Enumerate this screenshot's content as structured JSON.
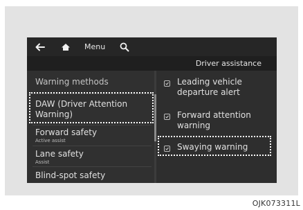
{
  "topbar": {
    "back_icon": "arrow-left-icon",
    "home_icon": "home-icon",
    "menu_label": "Menu",
    "search_icon": "search-icon"
  },
  "header": {
    "title": "Driver assistance"
  },
  "left_menu": {
    "items": [
      {
        "label": "Warning methods",
        "sub": ""
      },
      {
        "label": "DAW (Driver Attention Warning)",
        "sub": ""
      },
      {
        "label": "Forward safety",
        "sub": "Active assist"
      },
      {
        "label": "Lane safety",
        "sub": "Assist"
      },
      {
        "label": "Blind-spot safety",
        "sub": ""
      }
    ]
  },
  "options": [
    {
      "label": "Leading vehicle departure alert",
      "checked": true
    },
    {
      "label": "Forward attention warning",
      "checked": true
    },
    {
      "label": "Swaying warning",
      "checked": true
    }
  ],
  "caption": "OJK073311L",
  "colors": {
    "screen_bg": "#2e2e2e",
    "topbar_bg": "#262626",
    "subbar_bg": "#1f1f1f",
    "text": "#e0e0e0",
    "highlight_border": "#ffffff",
    "frame_bg": "#e3e3e3"
  }
}
